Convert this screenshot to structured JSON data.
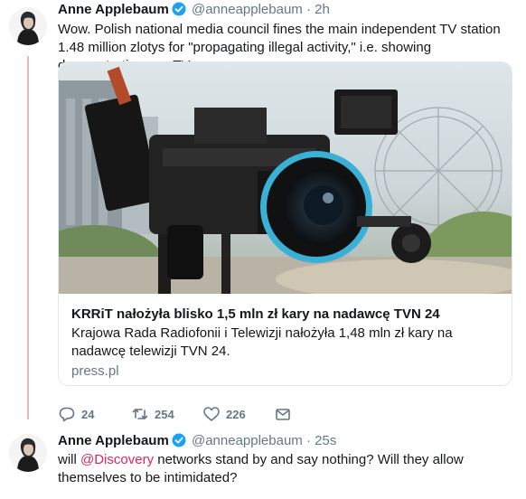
{
  "tweets": [
    {
      "author_name": "Anne Applebaum",
      "handle": "@anneapplebaum",
      "separator": "·",
      "time": "2h",
      "text": "Wow. Polish national media council fines the main independent TV station 1.48 million zlotys for \"propagating illegal activity,\" i.e. showing demonstrations on TV",
      "card": {
        "title": "KRRiT nałożyła blisko 1,5 mln zł kary na nadawcę TVN 24",
        "description": "Krajowa Rada Radiofonii i Telewizji nałożyła 1,48 mln zł kary na nadawcę telewizji TVN 24.",
        "domain": "press.pl"
      },
      "actions": {
        "replies": "24",
        "retweets": "254",
        "likes": "226"
      }
    },
    {
      "author_name": "Anne Applebaum",
      "handle": "@anneapplebaum",
      "separator": "·",
      "time": "25s",
      "text_before": "will ",
      "mention": "@Discovery",
      "text_after": " networks stand by and say nothing? Will they allow themselves to be intimidated?"
    }
  ],
  "colors": {
    "text": "#14171a",
    "secondary": "#657786",
    "verified": "#1da1f2",
    "mention": "#e0245e",
    "thread_line": "#e6b8b4",
    "border": "#e1e8ed"
  },
  "icons": [
    "verified-badge-icon",
    "reply-icon",
    "retweet-icon",
    "like-icon",
    "message-icon"
  ]
}
